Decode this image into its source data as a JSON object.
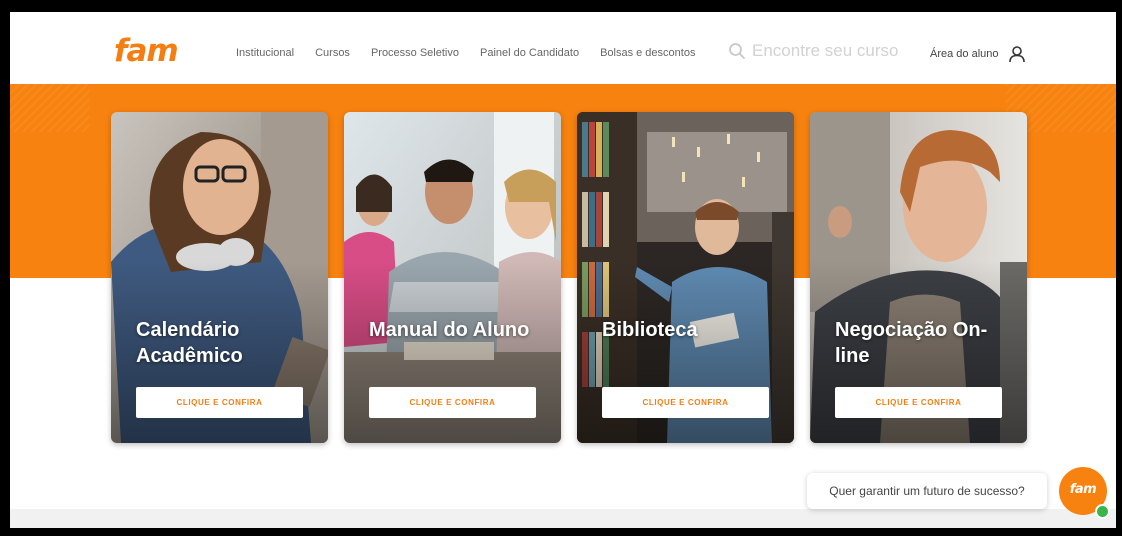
{
  "header": {
    "logo_text": "fam",
    "nav": [
      "Institucional",
      "Cursos",
      "Processo Seletivo",
      "Painel do Candidato",
      "Bolsas e descontos"
    ],
    "search_placeholder": "Encontre seu curso",
    "student_area": "Área do aluno"
  },
  "cards": [
    {
      "title": "Calendário Acadêmico",
      "cta": "CLIQUE E CONFIRA"
    },
    {
      "title": "Manual do Aluno",
      "cta": "CLIQUE E CONFIRA"
    },
    {
      "title": "Biblioteca",
      "cta": "CLIQUE E CONFIRA"
    },
    {
      "title": "Negociação On-line",
      "cta": "CLIQUE E CONFIRA"
    }
  ],
  "chat": {
    "prompt": "Quer garantir um futuro de sucesso?",
    "button_logo": "fam"
  },
  "colors": {
    "brand_orange": "#f7820f",
    "online_green": "#39b54a"
  },
  "icons": [
    "search-icon",
    "user-icon"
  ]
}
